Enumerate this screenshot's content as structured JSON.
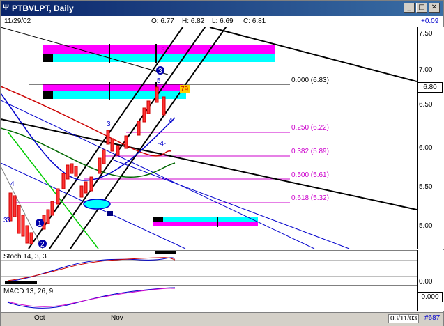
{
  "window": {
    "title": "PTBVLPT, Daily",
    "app_icon": "Ψ"
  },
  "titlebar_buttons": [
    "_",
    "□",
    "✕"
  ],
  "header": {
    "date": "11/29/02",
    "open": "O: 6.77",
    "high": "H: 6.82",
    "low": "L: 6.69",
    "close": "C: 6.81",
    "change": "+0.09"
  },
  "price_axis": {
    "ticks": [
      "7.50",
      "7.00",
      "6.50",
      "6.00",
      "5.50",
      "5.00"
    ],
    "current": "6.80"
  },
  "fib_levels": [
    {
      "label": "0.000 (6.83)",
      "color": "#000000"
    },
    {
      "label": "0.250 (6.22)",
      "color": "#cc00cc"
    },
    {
      "label": "0.382 (5.89)",
      "color": "#cc00cc"
    },
    {
      "label": "0.500 (5.61)",
      "color": "#cc00cc"
    },
    {
      "label": "0.618 (5.32)",
      "color": "#cc00cc"
    }
  ],
  "wave_labels": [
    "3",
    "3",
    "5",
    "3",
    "4",
    "4",
    "-4-",
    "3",
    "1",
    "2",
    "79"
  ],
  "circle_labels": [
    "1",
    "2",
    "3"
  ],
  "stoch": {
    "label": "Stoch 14, 3, 3",
    "axis": "0.00"
  },
  "macd": {
    "label": "MACD 13, 26, 9",
    "value": "0.000"
  },
  "time_axis": {
    "labels": [
      "Oct",
      "Nov"
    ],
    "last_date": "03/11/03",
    "count": "#687"
  },
  "colors": {
    "magenta": "#ff00ff",
    "cyan": "#00ffff",
    "up": "#cc0000",
    "channel": "#000000",
    "blue": "#0000cc",
    "green": "#008000"
  }
}
